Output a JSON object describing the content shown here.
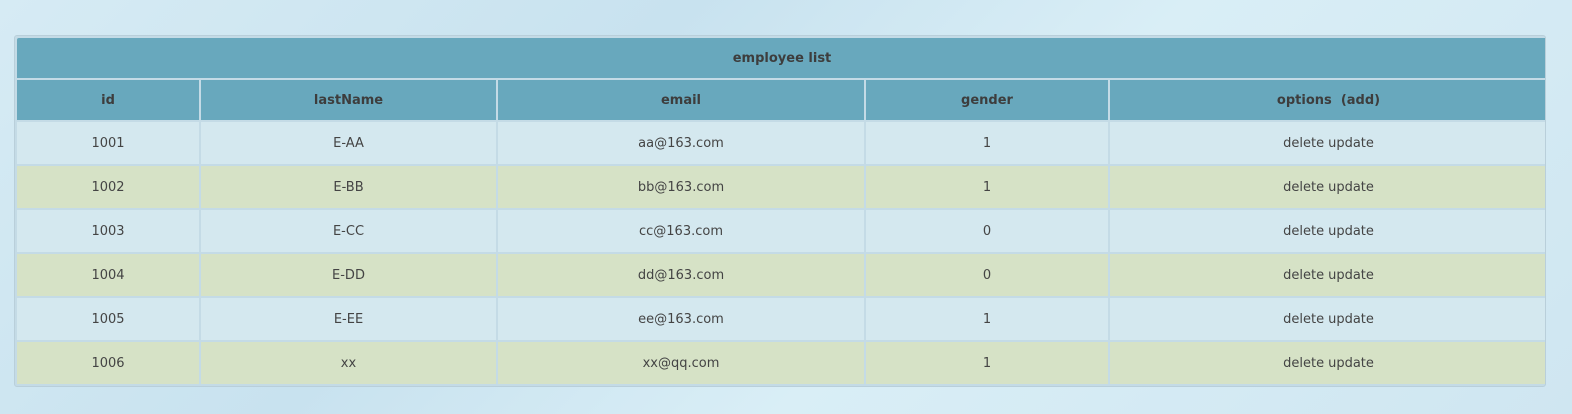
{
  "table": {
    "caption": "employee list",
    "headers": {
      "id": "id",
      "lastName": "lastName",
      "email": "email",
      "gender": "gender",
      "options": "options",
      "add": "(add)"
    },
    "rows": [
      {
        "id": "1001",
        "lastName": "E-AA",
        "email": "aa@163.com",
        "gender": "1",
        "delete": "delete",
        "update": "update"
      },
      {
        "id": "1002",
        "lastName": "E-BB",
        "email": "bb@163.com",
        "gender": "1",
        "delete": "delete",
        "update": "update"
      },
      {
        "id": "1003",
        "lastName": "E-CC",
        "email": "cc@163.com",
        "gender": "0",
        "delete": "delete",
        "update": "update"
      },
      {
        "id": "1004",
        "lastName": "E-DD",
        "email": "dd@163.com",
        "gender": "0",
        "delete": "delete",
        "update": "update"
      },
      {
        "id": "1005",
        "lastName": "E-EE",
        "email": "ee@163.com",
        "gender": "1",
        "delete": "delete",
        "update": "update"
      },
      {
        "id": "1006",
        "lastName": "xx",
        "email": "xx@qq.com",
        "gender": "1",
        "delete": "delete",
        "update": "update"
      }
    ]
  },
  "colors": {
    "header_bg": "#68a8bd",
    "row_odd_bg": "#d4e8ef",
    "row_even_bg": "#d6e2c6"
  }
}
